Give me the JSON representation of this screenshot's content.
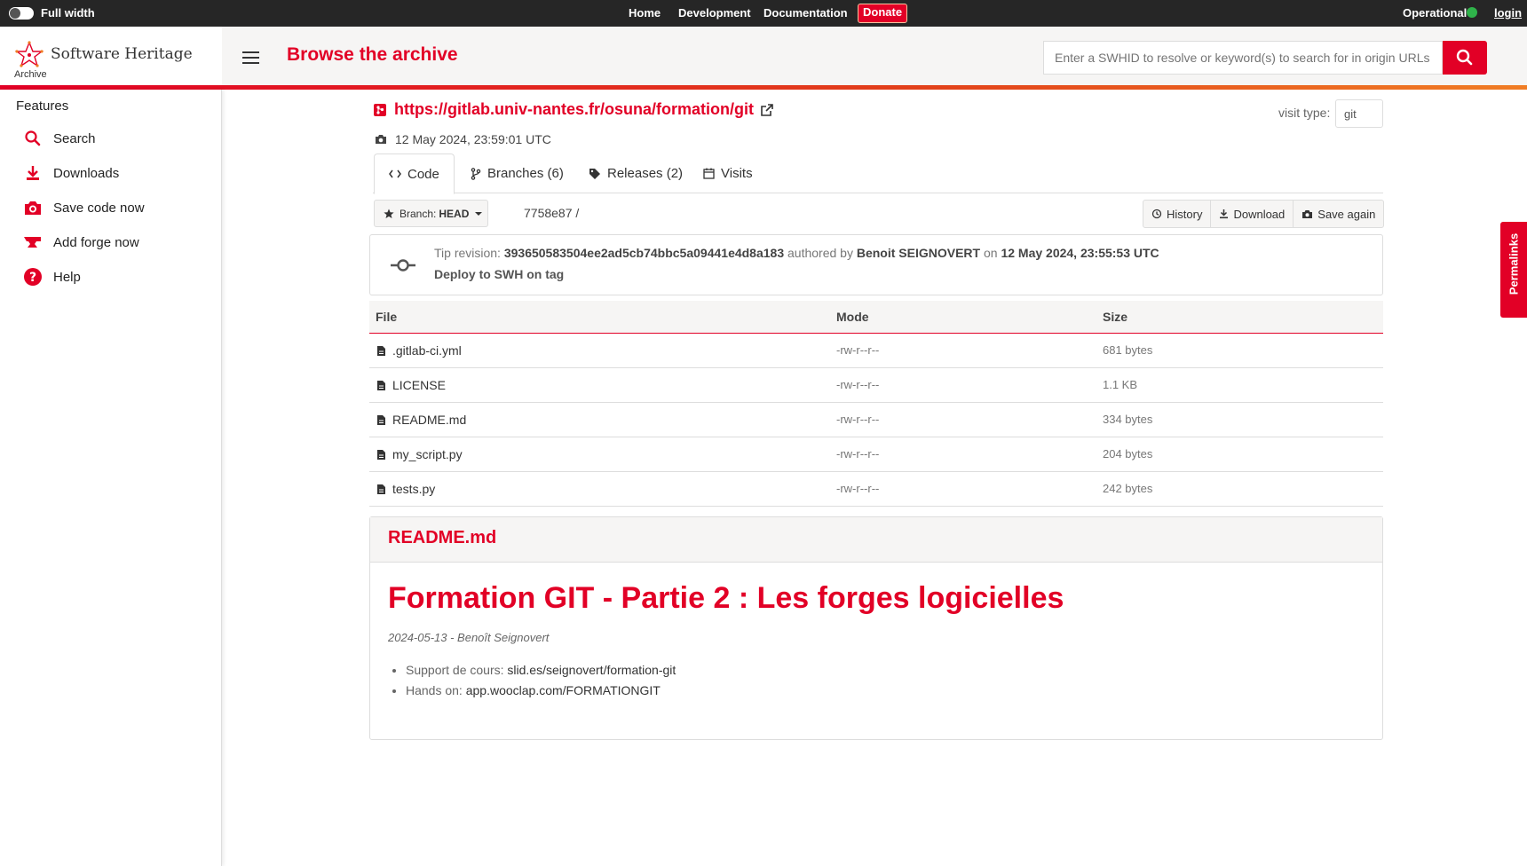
{
  "topbar": {
    "full_width_label": "Full width",
    "nav": [
      "Home",
      "Development",
      "Documentation"
    ],
    "donate_label": "Donate",
    "status_label": "Operational",
    "status_color": "#2fb34a",
    "login_label": "login"
  },
  "header": {
    "logo_title": "Software Heritage",
    "logo_subtitle": "Archive",
    "page_title": "Browse the archive",
    "search_placeholder": "Enter a SWHID to resolve or keyword(s) to search for in origin URLs",
    "accent_color": "#e20026"
  },
  "sidebar": {
    "section_label": "Features",
    "items": [
      {
        "label": "Search",
        "icon": "magnifier-icon"
      },
      {
        "label": "Downloads",
        "icon": "download-icon"
      },
      {
        "label": "Save code now",
        "icon": "camera-icon"
      },
      {
        "label": "Add forge now",
        "icon": "anvil-icon"
      },
      {
        "label": "Help",
        "icon": "help-circle-icon"
      }
    ]
  },
  "origin": {
    "url": "https://gitlab.univ-nantes.fr/osuna/formation/git",
    "visit_date": "12 May 2024, 23:59:01 UTC",
    "visit_type_label": "visit type:",
    "visit_type_value": "git"
  },
  "tabs": [
    {
      "label": "Code",
      "icon": "code-icon"
    },
    {
      "label": "Branches (6)",
      "icon": "branch-icon"
    },
    {
      "label": "Releases (2)",
      "icon": "tag-icon"
    },
    {
      "label": "Visits",
      "icon": "calendar-icon"
    }
  ],
  "toolbar": {
    "branch_prefix": "Branch:",
    "branch_value": "HEAD",
    "breadcrumb": "7758e87 /",
    "buttons": [
      "History",
      "Download",
      "Save again"
    ]
  },
  "revision": {
    "tip_label": "Tip revision:",
    "hash": "393650583504ee2ad5cb74bbc5a09441e4d8a183",
    "authored_by_label": "authored by",
    "author": "Benoit SEIGNOVERT",
    "on_label": "on",
    "date": "12 May 2024, 23:55:53 UTC",
    "message": "Deploy to SWH on tag"
  },
  "files": {
    "headers": [
      "File",
      "Mode",
      "Size"
    ],
    "rows": [
      {
        "name": ".gitlab-ci.yml",
        "mode": "-rw-r--r--",
        "size": "681 bytes"
      },
      {
        "name": "LICENSE",
        "mode": "-rw-r--r--",
        "size": "1.1 KB"
      },
      {
        "name": "README.md",
        "mode": "-rw-r--r--",
        "size": "334 bytes"
      },
      {
        "name": "my_script.py",
        "mode": "-rw-r--r--",
        "size": "204 bytes"
      },
      {
        "name": "tests.py",
        "mode": "-rw-r--r--",
        "size": "242 bytes"
      }
    ]
  },
  "readme": {
    "filename": "README.md",
    "heading": "Formation GIT - Partie 2 : Les forges logicielles",
    "meta": "2024-05-13 - Benoît Seignovert",
    "items": [
      {
        "label": "Support de cours:",
        "link": "slid.es/seignovert/formation-git"
      },
      {
        "label": "Hands on:",
        "link": "app.wooclap.com/FORMATIONGIT"
      }
    ]
  },
  "permalinks_label": "Permalinks"
}
